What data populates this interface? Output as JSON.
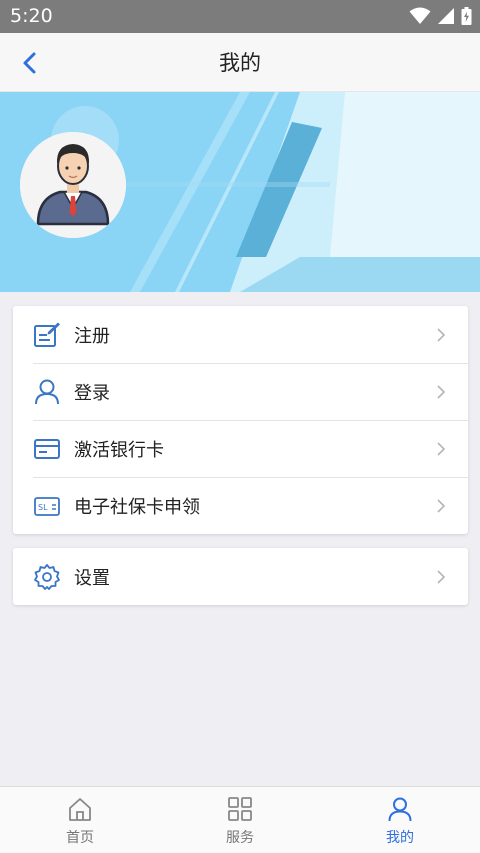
{
  "status_bar": {
    "time": "5:20"
  },
  "header": {
    "title": "我的"
  },
  "menu": {
    "items": [
      {
        "label": "注册",
        "icon": "edit-document-icon"
      },
      {
        "label": "登录",
        "icon": "user-icon"
      },
      {
        "label": "激活银行卡",
        "icon": "bank-card-icon"
      },
      {
        "label": "电子社保卡申领",
        "icon": "social-security-card-icon"
      }
    ],
    "settings": {
      "label": "设置",
      "icon": "gear-icon"
    }
  },
  "social_card_icon_text": "SL",
  "bottom_nav": {
    "items": [
      {
        "label": "首页",
        "icon": "home-icon",
        "active": false
      },
      {
        "label": "服务",
        "icon": "grid-icon",
        "active": false
      },
      {
        "label": "我的",
        "icon": "user-icon",
        "active": true
      }
    ]
  },
  "colors": {
    "accent": "#2f6fde",
    "icon_blue": "#3a76c4",
    "banner": "#8ad4f5"
  }
}
